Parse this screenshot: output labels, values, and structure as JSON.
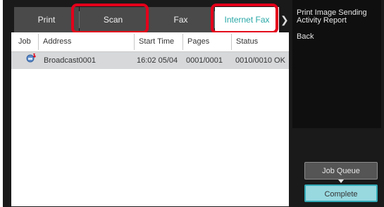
{
  "tabs": [
    {
      "label": "Print"
    },
    {
      "label": "Scan"
    },
    {
      "label": "Fax"
    },
    {
      "label": "Internet Fax"
    }
  ],
  "columns": [
    "Job",
    "Address",
    "Start Time",
    "Pages",
    "Status"
  ],
  "rows": [
    {
      "address": "Broadcast0001",
      "start_time": "16:02 05/04",
      "pages": "0001/0001",
      "status": "0010/0010 OK"
    }
  ],
  "side_menu": {
    "print_report": "Print Image Sending Activity Report",
    "back": "Back"
  },
  "buttons": {
    "job_queue": "Job Queue",
    "complete": "Complete"
  },
  "colors": {
    "highlight": "#e3001b",
    "active_tab_text": "#2aa7a7"
  }
}
